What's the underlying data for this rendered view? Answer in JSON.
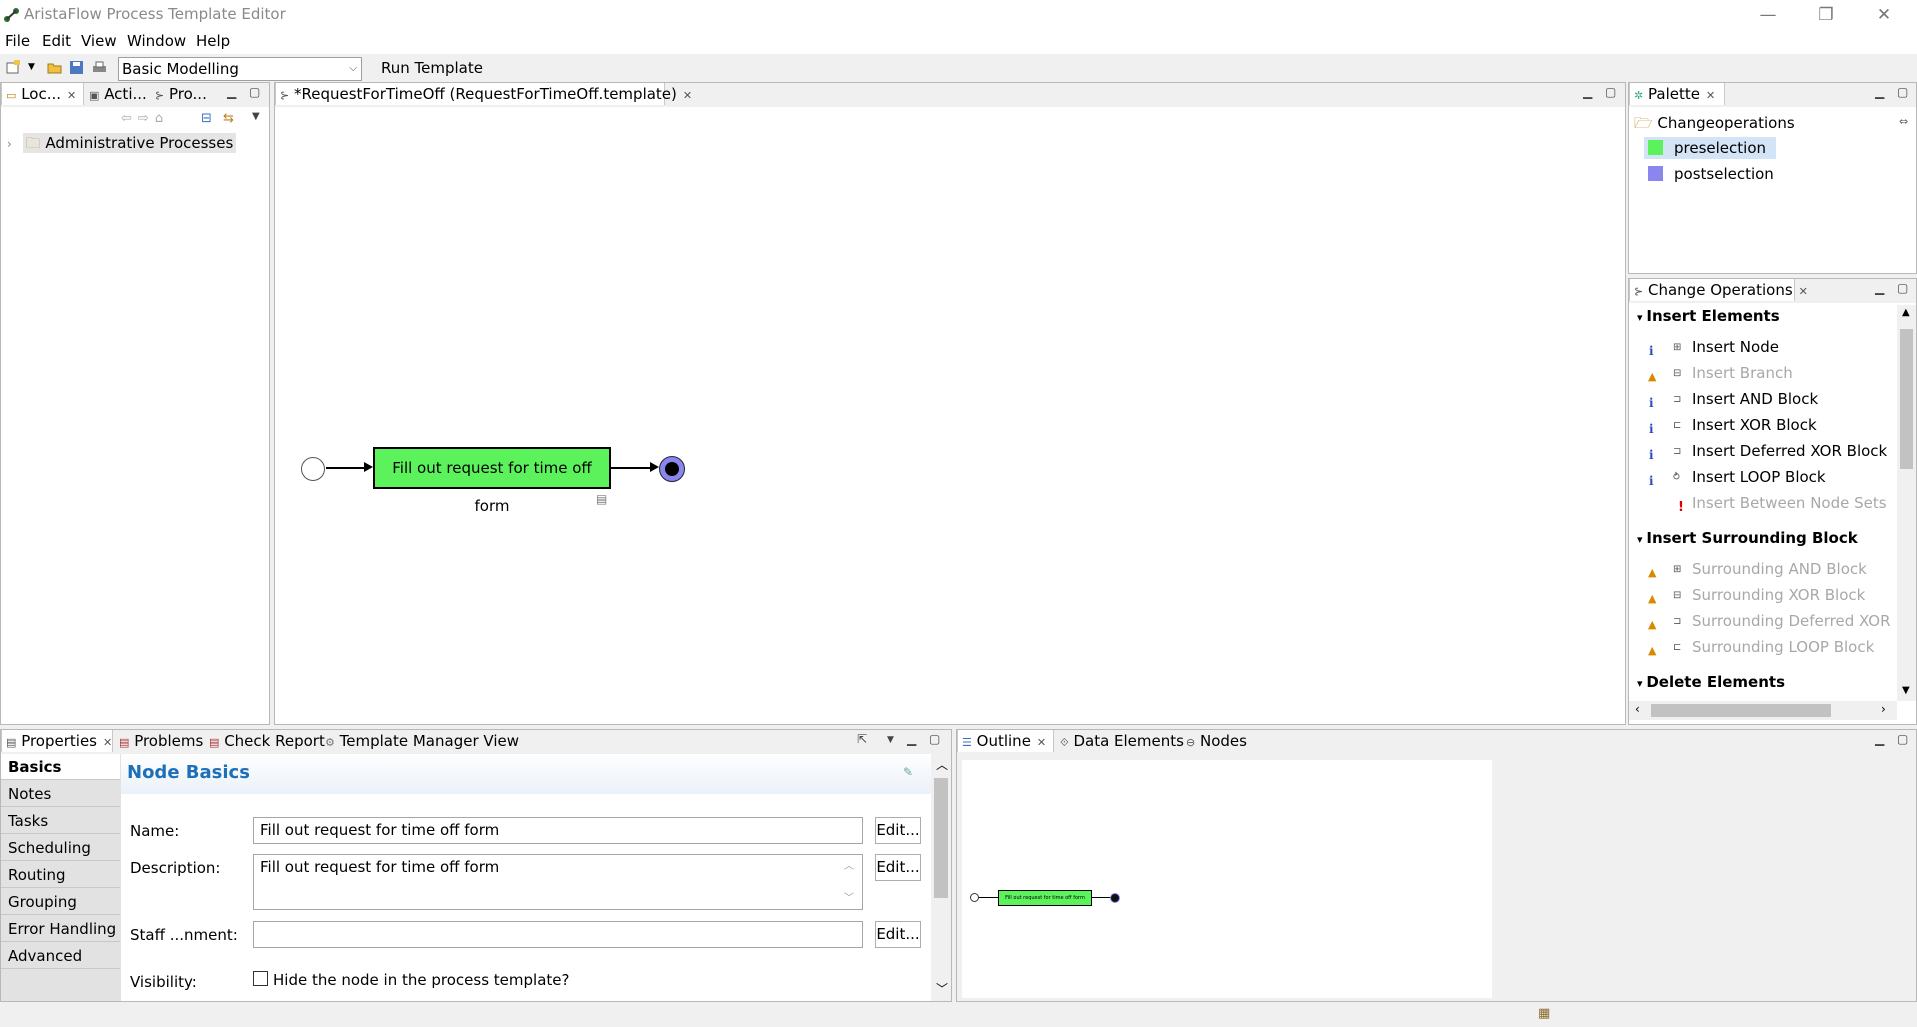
{
  "window": {
    "title": "AristaFlow Process Template Editor",
    "minimize": "—",
    "restore": "❐",
    "close": "✕"
  },
  "menu": [
    "File",
    "Edit",
    "View",
    "Window",
    "Help"
  ],
  "toolbar": {
    "perspective": "Basic Modelling",
    "run_template": "Run Template"
  },
  "left_panel": {
    "tabs": [
      "Loc...",
      "Acti...",
      "Pro..."
    ],
    "tree": [
      {
        "label": "Administrative Processes"
      }
    ]
  },
  "editor": {
    "tab_label": "*RequestForTimeOff (RequestForTimeOff.template)",
    "node_label": "Fill out request for time off form",
    "node_color": "#5cf25c",
    "end_node_color": "#8a86f0"
  },
  "palette": {
    "tab_label": "Palette",
    "group": "Changeoperations",
    "items": [
      {
        "label": "preselection",
        "color": "#5cf25c"
      },
      {
        "label": "postselection",
        "color": "#8a86f0"
      }
    ]
  },
  "change_operations": {
    "tab_label": "Change Operations",
    "sections": [
      {
        "title": "Insert Elements",
        "items": [
          {
            "label": "Insert Node",
            "status": "info",
            "enabled": true
          },
          {
            "label": "Insert Branch",
            "status": "warn",
            "enabled": false
          },
          {
            "label": "Insert AND Block",
            "status": "info",
            "enabled": true
          },
          {
            "label": "Insert XOR Block",
            "status": "info",
            "enabled": true
          },
          {
            "label": "Insert Deferred XOR Block",
            "status": "info",
            "enabled": true
          },
          {
            "label": "Insert LOOP Block",
            "status": "info",
            "enabled": true
          },
          {
            "label": "Insert Between Node Sets",
            "status": "error",
            "enabled": false
          }
        ]
      },
      {
        "title": "Insert Surrounding Block",
        "items": [
          {
            "label": "Surrounding AND Block",
            "status": "warn",
            "enabled": false
          },
          {
            "label": "Surrounding XOR Block",
            "status": "warn",
            "enabled": false
          },
          {
            "label": "Surrounding Deferred XOR Blo",
            "status": "warn",
            "enabled": false
          },
          {
            "label": "Surrounding LOOP Block",
            "status": "warn",
            "enabled": false
          }
        ]
      },
      {
        "title": "Delete Elements",
        "items": []
      }
    ]
  },
  "bottom_tabs": [
    "Properties",
    "Problems",
    "Check Report",
    "Template Manager View"
  ],
  "properties": {
    "side_tabs": [
      "Basics",
      "Notes",
      "Tasks",
      "Scheduling",
      "Routing",
      "Grouping",
      "Error Handling",
      "Advanced"
    ],
    "heading": "Node Basics",
    "name_label": "Name:",
    "name_value": "Fill out request for time off form",
    "description_label": "Description:",
    "description_value": "Fill out request for time off form",
    "staff_label": "Staff ...nment:",
    "staff_value": "",
    "visibility_label": "Visibility:",
    "visibility_checkbox": "Hide the node in the process template?",
    "visibility_checked": false,
    "edit_button": "Edit..."
  },
  "outline": {
    "tabs": [
      "Outline",
      "Data Elements",
      "Nodes"
    ],
    "node_label": "Fill out request for time off form"
  }
}
